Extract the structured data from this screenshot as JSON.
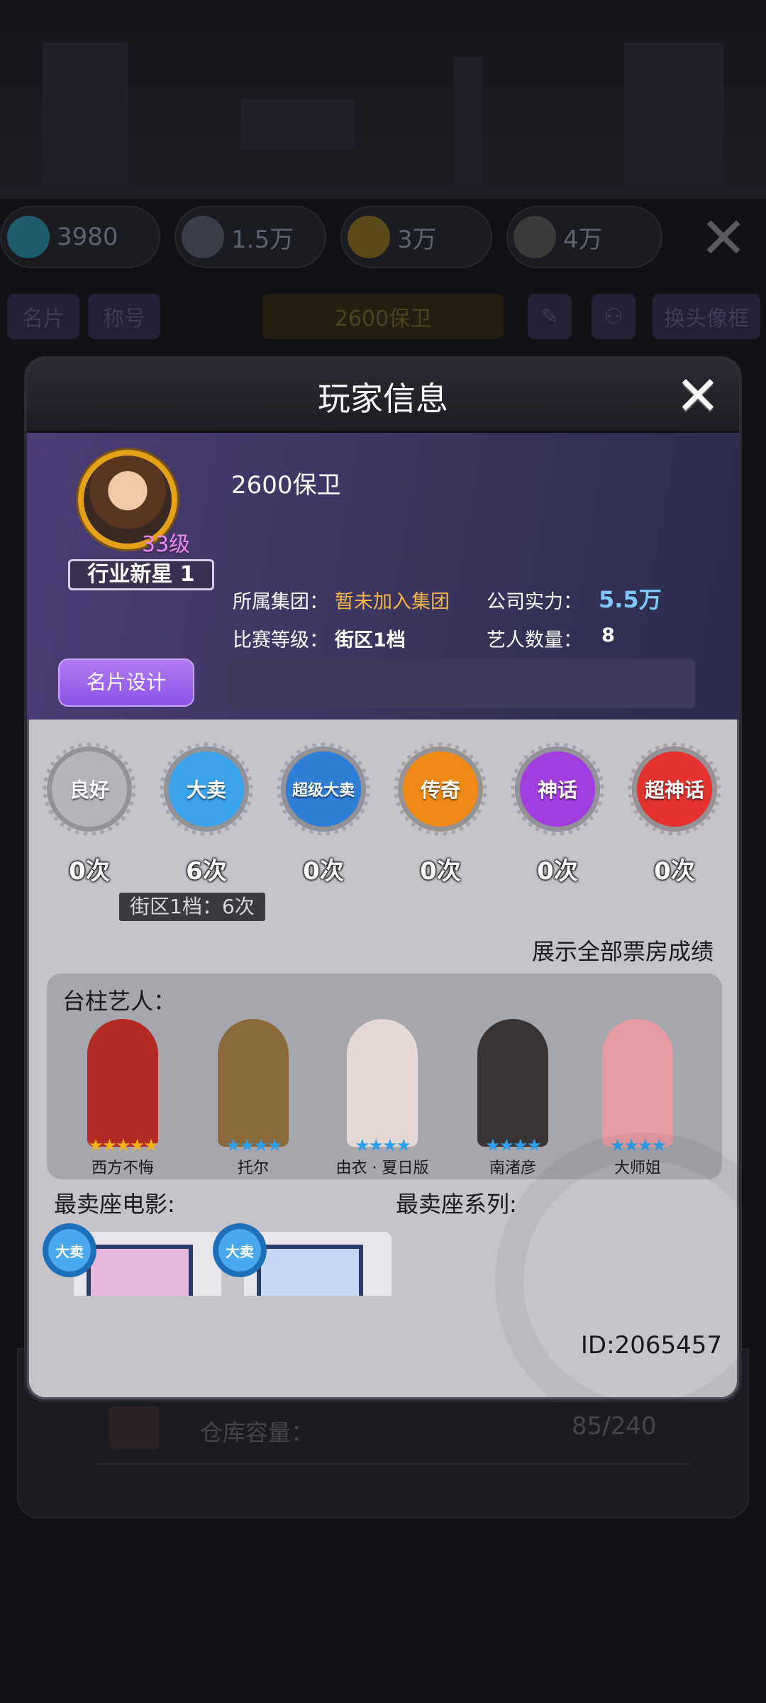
{
  "background": {
    "resources": [
      {
        "icon": "diamond-icon",
        "value": "3980",
        "color": "#2aa8c8"
      },
      {
        "icon": "thumbs-up-icon",
        "value": "1.5万",
        "color": "#7a8090"
      },
      {
        "icon": "boot-icon",
        "value": "3万",
        "color": "#b89a2a"
      },
      {
        "icon": "money-icon",
        "value": "4万",
        "color": "#8a8a8a"
      }
    ],
    "tabs": [
      "名片",
      "称号"
    ],
    "player_name": "2600保卫",
    "change_frame": "换头像框",
    "storage_label": "仓库容量：",
    "storage_value": "85/240"
  },
  "dialog": {
    "title": "玩家信息",
    "close": "✕"
  },
  "profile": {
    "name": "2600保卫",
    "level": "33级",
    "rank_title": "行业新星 1",
    "group_label": "所属集团：",
    "group_value": "暂未加入集团",
    "power_label": "公司实力：",
    "power_value": "5.5万",
    "match_label": "比赛等级：",
    "match_value": "街区1档",
    "artist_count_label": "艺人数量：",
    "artist_count_value": "8",
    "design_button": "名片设计"
  },
  "badges": [
    {
      "label": "良好",
      "count": "0次",
      "color": "#b4b4ba",
      "icon": "good-badge-icon"
    },
    {
      "label": "大卖",
      "count": "6次",
      "color": "#3aa3ec",
      "icon": "big-sale-badge-icon"
    },
    {
      "label": "超级大卖",
      "count": "0次",
      "color": "#2f7ed8",
      "icon": "super-sale-badge-icon"
    },
    {
      "label": "传奇",
      "count": "0次",
      "color": "#ef8a16",
      "icon": "legend-badge-icon"
    },
    {
      "label": "神话",
      "count": "0次",
      "color": "#a23ee0",
      "icon": "myth-badge-icon"
    },
    {
      "label": "超神话",
      "count": "0次",
      "color": "#e4332f",
      "icon": "super-myth-badge-icon"
    }
  ],
  "badge_tooltip": "街区1档：6次",
  "show_all_link": "展示全部票房成绩",
  "artists": {
    "title": "台柱艺人：",
    "items": [
      {
        "name": "西方不悔",
        "stars": "★★★★★",
        "star_color": "#f4b31a",
        "color": "#b42a24"
      },
      {
        "name": "托尔",
        "stars": "★★★★",
        "star_color": "#2fa0ee",
        "color": "#8a6a3a"
      },
      {
        "name": "由衣 · 夏日版",
        "stars": "★★★★",
        "star_color": "#2fa0ee",
        "color": "#e6d8d4"
      },
      {
        "name": "南渚彦",
        "stars": "★★★★",
        "star_color": "#2fa0ee",
        "color": "#3a3434"
      },
      {
        "name": "大师姐",
        "stars": "★★★★",
        "star_color": "#2fa0ee",
        "color": "#e69aa4"
      }
    ]
  },
  "best_movie_label": "最卖座电影:",
  "best_series_label": "最卖座系列:",
  "movies": [
    {
      "badge": "大卖",
      "poster_color": "#e8b8dc"
    },
    {
      "badge": "大卖",
      "poster_color": "#c8d8f4"
    }
  ],
  "player_id": "ID:2065457"
}
